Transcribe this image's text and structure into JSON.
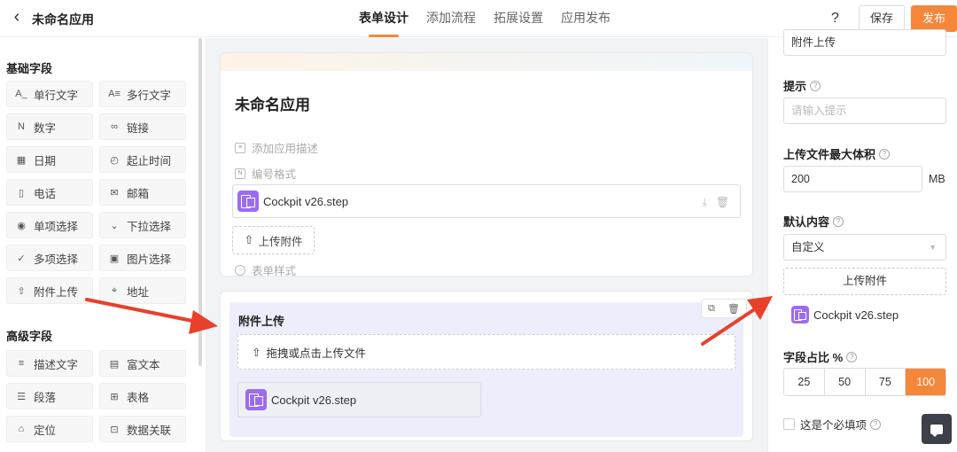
{
  "header": {
    "back_icon": "chevron-left-icon",
    "title": "未命名应用",
    "tabs": [
      "表单设计",
      "添加流程",
      "拓展设置",
      "应用发布"
    ],
    "help": "?",
    "save": "保存",
    "publish": "发布"
  },
  "left": {
    "basic_title": "基础字段",
    "basic_fields": [
      {
        "label": "单行文字",
        "icon": "A_"
      },
      {
        "label": "多行文字",
        "icon": "A≡"
      },
      {
        "label": "数字",
        "icon": "N"
      },
      {
        "label": "链接",
        "icon": "∞"
      },
      {
        "label": "日期",
        "icon": "▦"
      },
      {
        "label": "起止时间",
        "icon": "◴"
      },
      {
        "label": "电话",
        "icon": "▯"
      },
      {
        "label": "邮箱",
        "icon": "✉"
      },
      {
        "label": "单项选择",
        "icon": "◉"
      },
      {
        "label": "下拉选择",
        "icon": "⌄"
      },
      {
        "label": "多项选择",
        "icon": "✓"
      },
      {
        "label": "图片选择",
        "icon": "▣"
      },
      {
        "label": "附件上传",
        "icon": "⇧"
      },
      {
        "label": "地址",
        "icon": "⌖"
      }
    ],
    "advanced_title": "高级字段",
    "advanced_fields": [
      {
        "label": "描述文字",
        "icon": "≡"
      },
      {
        "label": "富文本",
        "icon": "▤"
      },
      {
        "label": "段落",
        "icon": "☰"
      },
      {
        "label": "表格",
        "icon": "⊞"
      },
      {
        "label": "定位",
        "icon": "⌂"
      },
      {
        "label": "数据关联",
        "icon": "⊡"
      }
    ]
  },
  "form": {
    "title": "未命名应用",
    "desc_hint": "添加应用描述",
    "number_hint": "编号格式",
    "file_name": "Cockpit v26.step",
    "upload_label": "上传附件",
    "style_hint": "表单样式"
  },
  "attach": {
    "label": "附件上传",
    "dropzone": "拖拽或点击上传文件",
    "file_name": "Cockpit v26.step"
  },
  "right": {
    "field_name_value": "附件上传",
    "tip_label": "提示",
    "tip_placeholder": "请输入提示",
    "max_size_label": "上传文件最大体积",
    "max_size_value": "200",
    "max_size_unit": "MB",
    "default_label": "默认内容",
    "default_select": "自定义",
    "upload_button": "上传附件",
    "file_name": "Cockpit v26.step",
    "ratio_label": "字段占比 %",
    "ratio_options": [
      "25",
      "50",
      "75",
      "100"
    ],
    "ratio_selected": "100",
    "required_label": "这是个必填项"
  },
  "colors": {
    "accent": "#f5873a",
    "file_icon": "#9b6cf3",
    "arrow": "#e8402a"
  }
}
